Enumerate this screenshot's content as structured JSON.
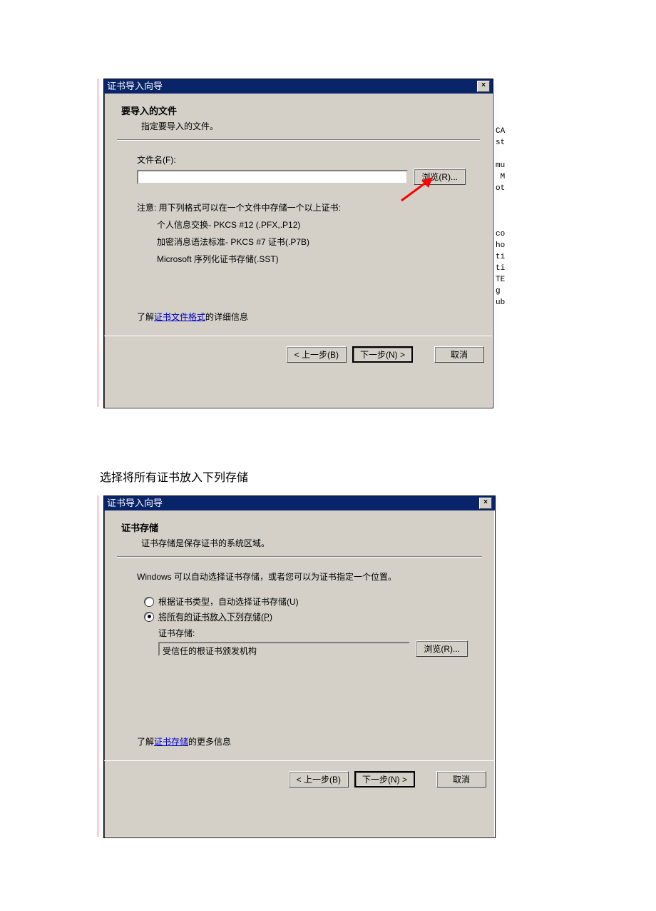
{
  "caption_between": "选择将所有证书放入下列存储",
  "dialog1": {
    "title": "证书导入向导",
    "close": "×",
    "header_title": "要导入的文件",
    "header_sub": "指定要导入的文件。",
    "filename_label": "文件名(F):",
    "filename_value": "",
    "browse": "浏览(R)...",
    "note_intro": "注意:  用下列格式可以在一个文件中存储一个以上证书:",
    "note_1": "个人信息交换- PKCS #12 (.PFX,.P12)",
    "note_2": "加密消息语法标准- PKCS #7 证书(.P7B)",
    "note_3": "Microsoft 序列化证书存储(.SST)",
    "learn_prefix": "了解",
    "learn_link": "证书文件格式",
    "learn_suffix": "的详细信息",
    "back": "< 上一步(B)",
    "next": "下一步(N) >",
    "cancel": "取消"
  },
  "dialog2": {
    "title": "证书导入向导",
    "close": "×",
    "header_title": "证书存储",
    "header_sub": "证书存储是保存证书的系统区域。",
    "intro": "Windows 可以自动选择证书存储，或者您可以为证书指定一个位置。",
    "opt_auto": "根据证书类型，自动选择证书存储(U)",
    "opt_all": "将所有的证书放入下列存储(P)",
    "store_label": "证书存储:",
    "store_value": "受信任的根证书颁发机构",
    "browse": "浏览(R)...",
    "learn_prefix": "了解",
    "learn_link": "证书存储",
    "learn_suffix": "的更多信息",
    "back": "< 上一步(B)",
    "next": "下一步(N) >",
    "cancel": "取消"
  },
  "bg_right_1": "CA\nst\n\nmu\n M\not\n\n\n\nco\nho\nti\nti\nTE\ng\nub"
}
